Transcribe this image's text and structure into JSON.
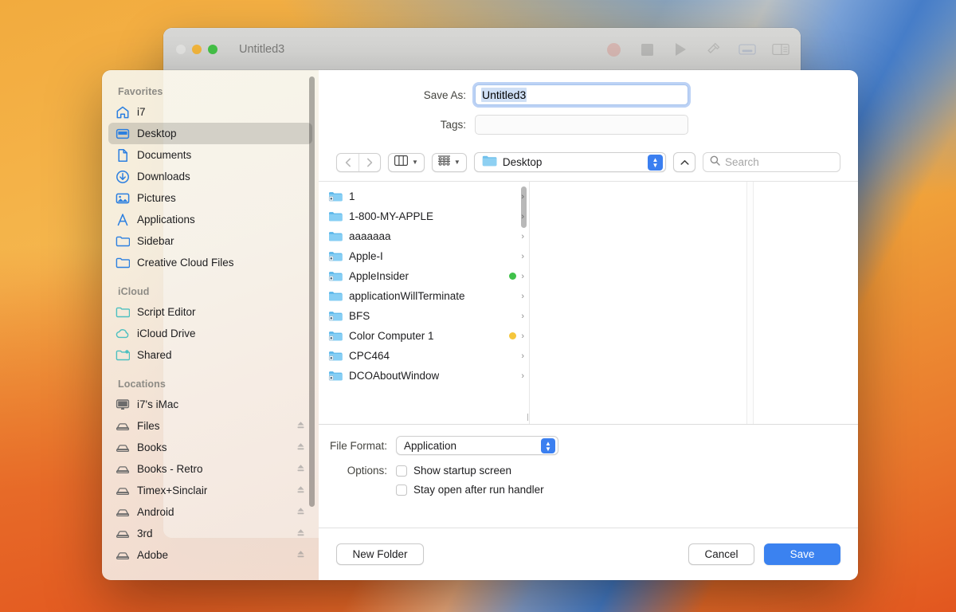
{
  "editor_window": {
    "title": "Untitled3",
    "traffic_lights": [
      "close-inactive",
      "minimize",
      "zoom"
    ],
    "toolbar_icons": [
      "record-icon",
      "stop-icon",
      "run-icon",
      "compile-hammer-icon",
      "log-panel-icon",
      "split-panel-icon"
    ]
  },
  "save_dialog": {
    "save_as": {
      "label": "Save As:",
      "value": "Untitled3"
    },
    "tags": {
      "label": "Tags:",
      "value": ""
    },
    "toolbar": {
      "back_icon": "chevron-left-icon",
      "forward_icon": "chevron-right-icon",
      "view_mode": "column-view-icon",
      "group_by": "group-by-icon",
      "path_label": "Desktop",
      "path_icon": "folder-icon",
      "collapse_icon": "chevron-up-icon",
      "search_placeholder": "Search",
      "search_icon": "search-icon"
    },
    "files": [
      {
        "name": "1",
        "icon": "folder-app-icon",
        "tag": null
      },
      {
        "name": "1-800-MY-APPLE",
        "icon": "folder-icon",
        "tag": null
      },
      {
        "name": "aaaaaaa",
        "icon": "folder-icon",
        "tag": null
      },
      {
        "name": "Apple-I",
        "icon": "folder-app-icon",
        "tag": null
      },
      {
        "name": "AppleInsider",
        "icon": "folder-app-icon",
        "tag": "#3fc14a"
      },
      {
        "name": "applicationWillTerminate",
        "icon": "folder-icon",
        "tag": null
      },
      {
        "name": "BFS",
        "icon": "folder-app-icon",
        "tag": null
      },
      {
        "name": "Color Computer 1",
        "icon": "folder-app-icon",
        "tag": "#f5c63c"
      },
      {
        "name": "CPC464",
        "icon": "folder-app-icon",
        "tag": null
      },
      {
        "name": "DCOAboutWindow",
        "icon": "folder-app-icon",
        "tag": null
      }
    ],
    "file_format": {
      "label": "File Format:",
      "value": "Application"
    },
    "options": {
      "label": "Options:",
      "items": [
        {
          "label": "Show startup screen",
          "checked": false
        },
        {
          "label": "Stay open after run handler",
          "checked": false
        }
      ]
    },
    "buttons": {
      "new_folder": "New Folder",
      "cancel": "Cancel",
      "save": "Save"
    },
    "accent_color": "#3b82f0"
  },
  "sidebar": {
    "sections": [
      {
        "header": "Favorites",
        "items": [
          {
            "label": "i7",
            "icon": "home-icon",
            "selected": false,
            "eject": false
          },
          {
            "label": "Desktop",
            "icon": "desktop-icon",
            "selected": true,
            "eject": false
          },
          {
            "label": "Documents",
            "icon": "document-icon",
            "selected": false,
            "eject": false
          },
          {
            "label": "Downloads",
            "icon": "download-icon",
            "selected": false,
            "eject": false
          },
          {
            "label": "Pictures",
            "icon": "pictures-icon",
            "selected": false,
            "eject": false
          },
          {
            "label": "Applications",
            "icon": "applications-icon",
            "selected": false,
            "eject": false
          },
          {
            "label": "Sidebar",
            "icon": "folder-icon",
            "selected": false,
            "eject": false
          },
          {
            "label": "Creative Cloud Files",
            "icon": "folder-icon",
            "selected": false,
            "eject": false
          }
        ]
      },
      {
        "header": "iCloud",
        "items": [
          {
            "label": "Script Editor",
            "icon": "icloud-folder-icon",
            "selected": false,
            "eject": false
          },
          {
            "label": "iCloud Drive",
            "icon": "icloud-icon",
            "selected": false,
            "eject": false
          },
          {
            "label": "Shared",
            "icon": "shared-folder-icon",
            "selected": false,
            "eject": false
          }
        ]
      },
      {
        "header": "Locations",
        "items": [
          {
            "label": "i7's iMac",
            "icon": "imac-icon",
            "selected": false,
            "eject": false
          },
          {
            "label": "Files",
            "icon": "drive-icon",
            "selected": false,
            "eject": true
          },
          {
            "label": "Books",
            "icon": "drive-icon",
            "selected": false,
            "eject": true
          },
          {
            "label": "Books - Retro",
            "icon": "drive-icon",
            "selected": false,
            "eject": true
          },
          {
            "label": "Timex+Sinclair",
            "icon": "drive-icon",
            "selected": false,
            "eject": true
          },
          {
            "label": "Android",
            "icon": "drive-icon",
            "selected": false,
            "eject": true
          },
          {
            "label": "3rd",
            "icon": "drive-icon",
            "selected": false,
            "eject": true
          },
          {
            "label": "Adobe",
            "icon": "drive-icon",
            "selected": false,
            "eject": true
          }
        ]
      }
    ]
  }
}
